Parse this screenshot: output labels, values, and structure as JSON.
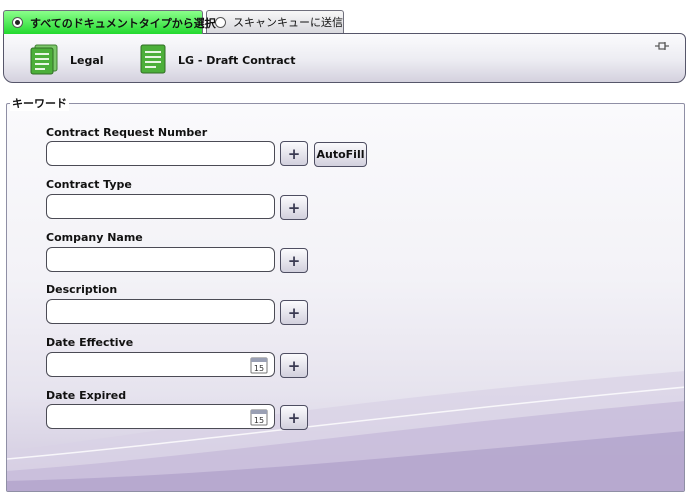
{
  "tabs": [
    {
      "label": "すべてのドキュメントタイプから選択",
      "selected": true
    },
    {
      "label": "スキャンキューに送信",
      "selected": false
    }
  ],
  "doc_types": [
    {
      "label": "Legal",
      "icon": "document-stack-icon"
    },
    {
      "label": "LG - Draft Contract",
      "icon": "document-icon"
    }
  ],
  "keywords": {
    "legend": "キーワード",
    "fields": [
      {
        "label": "Contract Request Number",
        "value": "",
        "add_label": "+",
        "has_calendar": false
      },
      {
        "label": "Contract Type",
        "value": "",
        "add_label": "+",
        "has_calendar": false
      },
      {
        "label": "Company Name",
        "value": "",
        "add_label": "+",
        "has_calendar": false
      },
      {
        "label": "Description",
        "value": "",
        "add_label": "+",
        "has_calendar": false
      },
      {
        "label": "Date Effective",
        "value": "",
        "add_label": "+",
        "has_calendar": true
      },
      {
        "label": "Date Expired",
        "value": "",
        "add_label": "+",
        "has_calendar": true
      }
    ],
    "autofill_label": "AutoFill",
    "calendar_day": "15"
  },
  "colors": {
    "active_tab": "#23d92f",
    "doc_icon": "#4caf3a",
    "background_accent": "#a898c4"
  }
}
